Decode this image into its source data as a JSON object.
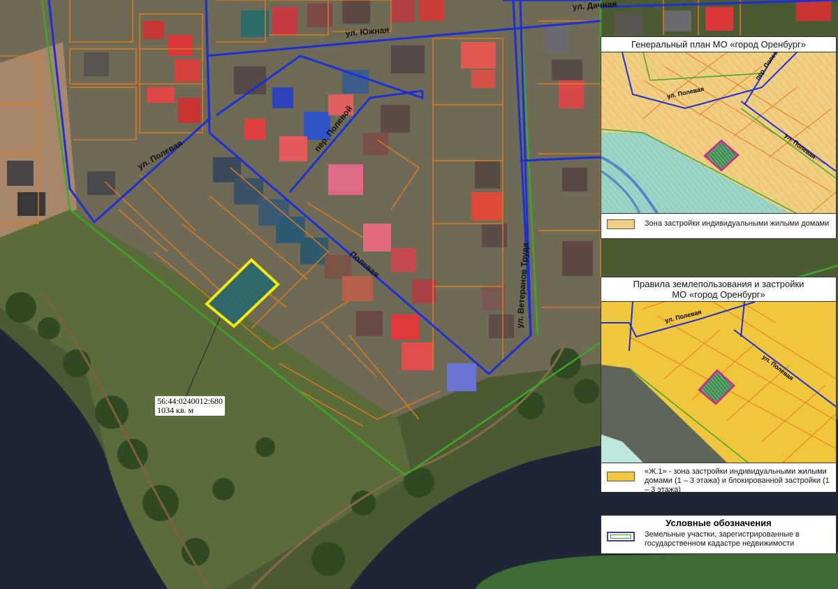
{
  "streets": {
    "yuzhnaya": "ул. Южная",
    "dachnaya": "ул. Дачная",
    "polevaya_west": "ул. Полевая",
    "polevaya_main": "Полевая",
    "per_polevoy": "пер. Полевой",
    "veteranov_truda": "ул. Ветеранов Труда"
  },
  "parcel": {
    "cadastral_number": "56:44:0240012:680",
    "area": "1034 кв. м"
  },
  "panel_general": {
    "title": "Генеральный план МО «город Оренбург»",
    "legend_text": "Зона застройки индивидуальными жилыми домами",
    "street_1": "ул. Полевая",
    "street_2": "пер. Полевой",
    "street_3": "ул. Полевая"
  },
  "panel_rules": {
    "title_line1": "Правила землепользования и застройки",
    "title_line2": "МО «город Оренбург»",
    "legend_text": "«Ж.1» - зона застройки индивидуальными жилыми домами (1 – 3 этажа) и блокированной застройки (1 – 3 этажа)",
    "street_1": "ул. Полевая",
    "street_2": "ул. Полевая"
  },
  "legend": {
    "title": "Условные обозначения",
    "item_text": "Земельные участки, зарегистрированные в государственном кадастре недвижимости"
  },
  "colors": {
    "road_blue": "#1a2fd6",
    "boundary_green": "#3ba82a",
    "cadastral_orange": "#e07a1e",
    "parcel_yellow": "#f2ea0c",
    "zone_yellow": "#f0c63c",
    "zone_light": "#f1cf82",
    "parcel_magenta": "#d6248f"
  }
}
